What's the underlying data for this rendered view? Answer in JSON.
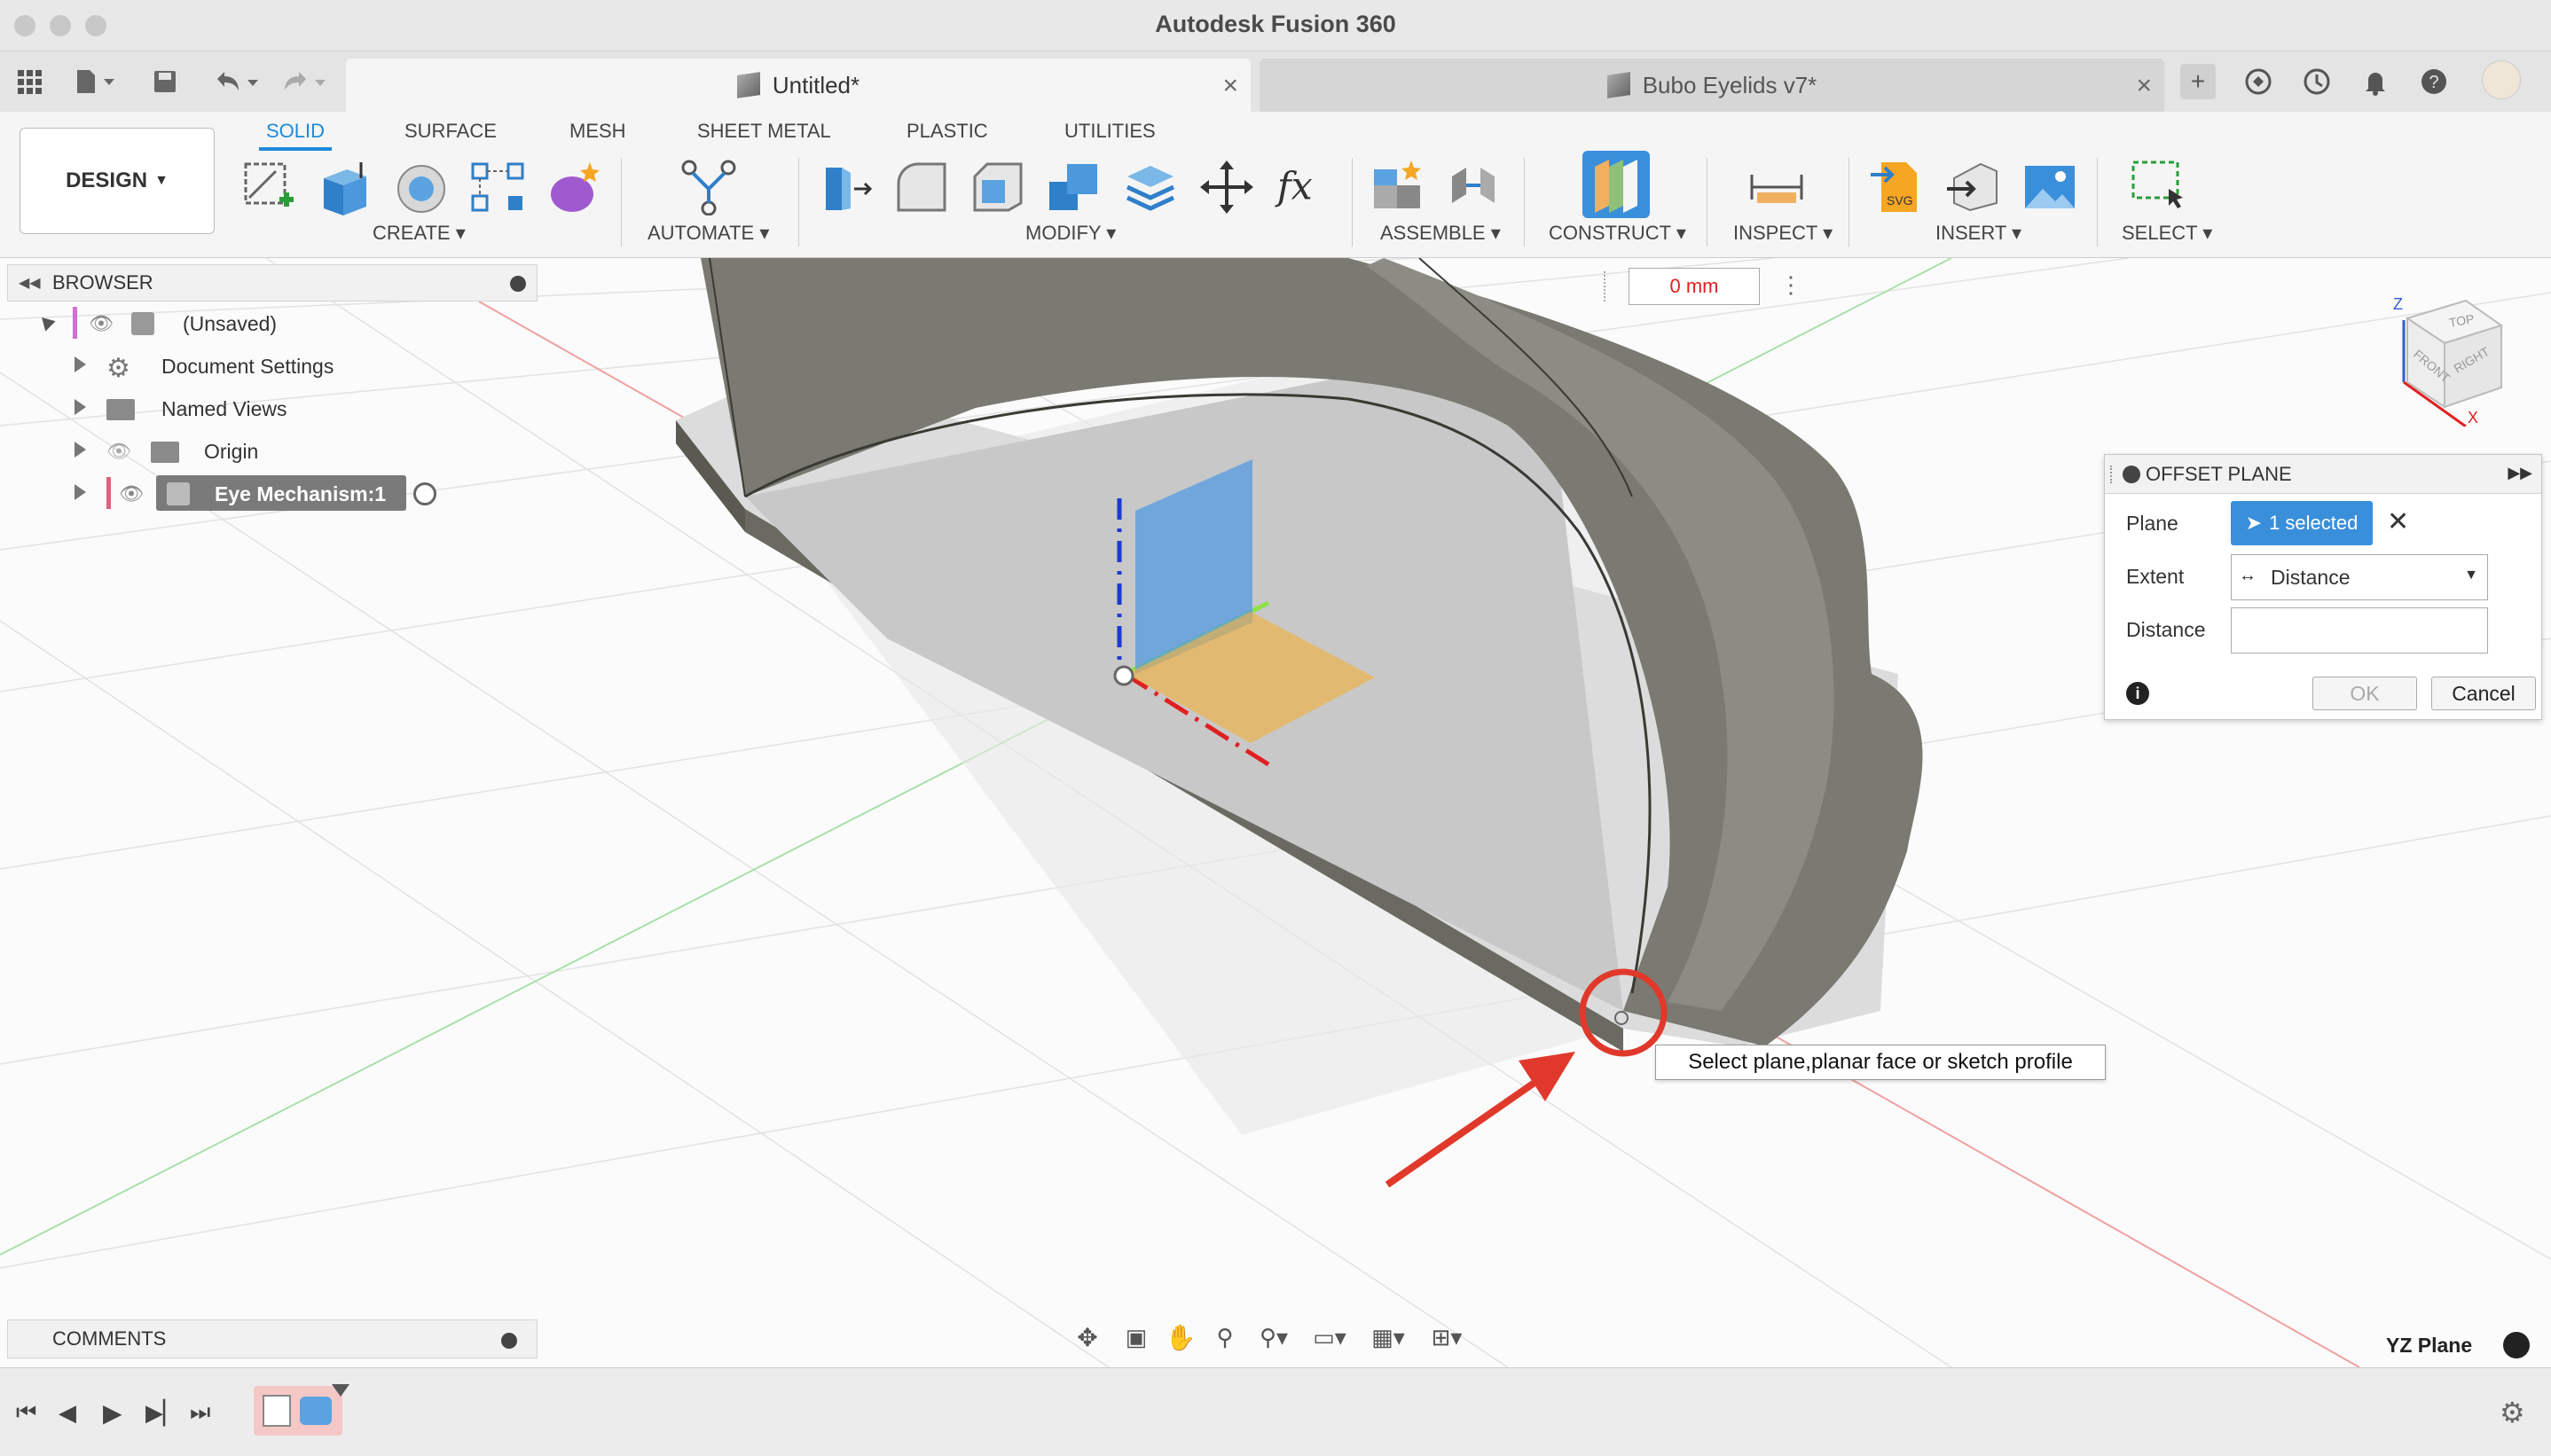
{
  "window": {
    "title": "Autodesk Fusion 360"
  },
  "tabs": [
    {
      "label": "Untitled*",
      "active": true
    },
    {
      "label": "Bubo Eyelids v7*",
      "active": false
    }
  ],
  "workspace": {
    "label": "DESIGN"
  },
  "ribbon": {
    "tabs": [
      "SOLID",
      "SURFACE",
      "MESH",
      "SHEET METAL",
      "PLASTIC",
      "UTILITIES"
    ],
    "active_tab": "SOLID",
    "groups": [
      "CREATE",
      "AUTOMATE",
      "MODIFY",
      "ASSEMBLE",
      "CONSTRUCT",
      "INSPECT",
      "INSERT",
      "SELECT"
    ]
  },
  "browser": {
    "title": "BROWSER",
    "items": [
      {
        "label": "(Unsaved)"
      },
      {
        "label": "Document Settings"
      },
      {
        "label": "Named Views"
      },
      {
        "label": "Origin"
      },
      {
        "label": "Eye Mechanism:1"
      }
    ]
  },
  "viewport": {
    "dimension_value": "0 mm",
    "tooltip": "Select plane,planar face or sketch profile",
    "active_plane": "YZ Plane",
    "viewcube": {
      "top": "TOP",
      "front": "FRONT",
      "right": "RIGHT",
      "axis_z": "Z",
      "axis_x": "X"
    }
  },
  "offset_plane": {
    "title": "OFFSET PLANE",
    "plane_label": "Plane",
    "plane_value": "1 selected",
    "extent_label": "Extent",
    "extent_value": "Distance",
    "distance_label": "Distance",
    "distance_value": "",
    "ok": "OK",
    "cancel": "Cancel"
  },
  "comments": {
    "label": "COMMENTS"
  },
  "colors": {
    "accent": "#1d8ad9",
    "selected": "#3a8fdb",
    "annotation": "#e0392b"
  }
}
